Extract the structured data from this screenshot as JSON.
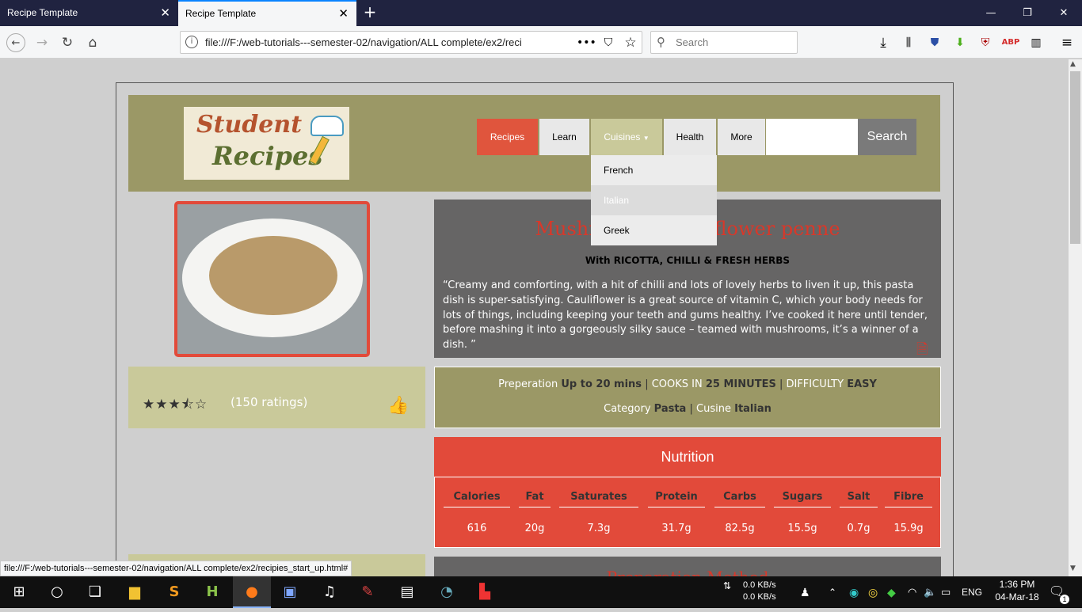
{
  "browser": {
    "tabs": [
      {
        "label": "Recipe Template"
      },
      {
        "label": "Recipe Template"
      }
    ],
    "url": "file:///F:/web-tutorials---semester-02/navigation/ALL complete/ex2/reci",
    "search_placeholder": "Search",
    "status_url": "file:///F:/web-tutorials---semester-02/navigation/ALL complete/ex2/recipies_start_up.html#"
  },
  "site": {
    "logo_line1": "Student",
    "logo_line2": "Recipes",
    "nav": {
      "recipes": "Recipes",
      "learn": "Learn",
      "cuisines": "Cuisines",
      "health": "Health",
      "more": "More"
    },
    "search_button": "Search",
    "dropdown": [
      "French",
      "Italian",
      "Greek"
    ]
  },
  "recipe": {
    "title": "Mushroom & cauliflower penne",
    "subtitle": "With RICOTTA, CHILLI & FRESH HERBS",
    "description": "“Creamy and comforting, with a hit of chilli and lots of lovely herbs to liven it up, this pasta dish is super-satisfying. Cauliflower is a great source of vitamin C, which your body needs for lots of things, including keeping your teeth and gums healthy. I’ve cooked it here until tender, before mashing it into a gorgeously silky sauce – teamed with mushrooms, it’s a winner of a dish. ”",
    "rating_stars": "★★★⯪☆",
    "rating_value": 3.5,
    "rating_count": "(150 ratings)",
    "prep_label": "Preperation",
    "prep_value": "Up to 20 mins",
    "cooks_label": "COOKS IN",
    "cooks_value": "25 MINUTES",
    "difficulty_label": "DIFFICULTY",
    "difficulty_value": "EASY",
    "category_label": "Category",
    "category_value": "Pasta",
    "cuisine_label": "Cusine",
    "cuisine_value": "Italian",
    "method_title": "Preparation Method"
  },
  "nutrition": {
    "title": "Nutrition",
    "headers": [
      "Calories",
      "Fat",
      "Saturates",
      "Protein",
      "Carbs",
      "Sugars",
      "Salt",
      "Fibre"
    ],
    "values": [
      "616",
      "20g",
      "7.3g",
      "31.7g",
      "82.5g",
      "15.5g",
      "0.7g",
      "15.9g"
    ]
  },
  "taskbar": {
    "net_down": "0.0 KB/s",
    "net_up": "0.0 KB/s",
    "language": "ENG",
    "time": "1:36 PM",
    "date": "04-Mar-18",
    "notifications": "1"
  },
  "colors": {
    "accent_red": "#e24a3a",
    "olive": "#9b9866",
    "pale_olive": "#c9c99a",
    "grey_panel": "#666565"
  }
}
